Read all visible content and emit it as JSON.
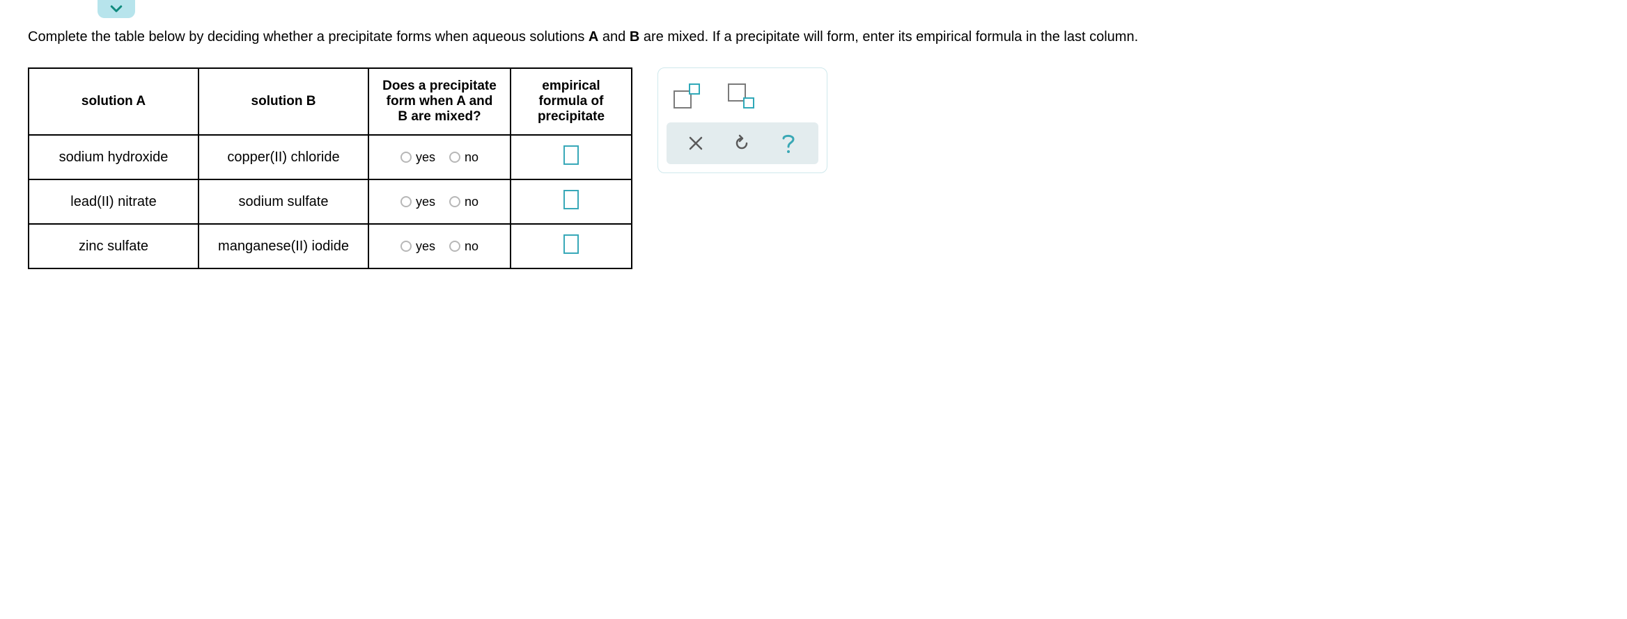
{
  "instructions_pre": "Complete the table below by deciding whether a precipitate forms when aqueous solutions ",
  "instructions_bold_a": "A",
  "instructions_mid": " and ",
  "instructions_bold_b": "B",
  "instructions_post": " are mixed. If a precipitate will form, enter its empirical formula in the last column.",
  "headers": {
    "a": "solution A",
    "b": "solution B",
    "c": "Does a precipitate form when A and B are mixed?",
    "d": "empirical formula of precipitate"
  },
  "rows": [
    {
      "a": "sodium hydroxide",
      "b": "copper(II) chloride",
      "yes": "yes",
      "no": "no"
    },
    {
      "a": "lead(II) nitrate",
      "b": "sodium sulfate",
      "yes": "yes",
      "no": "no"
    },
    {
      "a": "zinc sulfate",
      "b": "manganese(II) iodide",
      "yes": "yes",
      "no": "no"
    }
  ],
  "tools": {
    "superscript": "superscript",
    "subscript": "subscript",
    "clear": "clear",
    "reset": "reset",
    "help": "help"
  }
}
